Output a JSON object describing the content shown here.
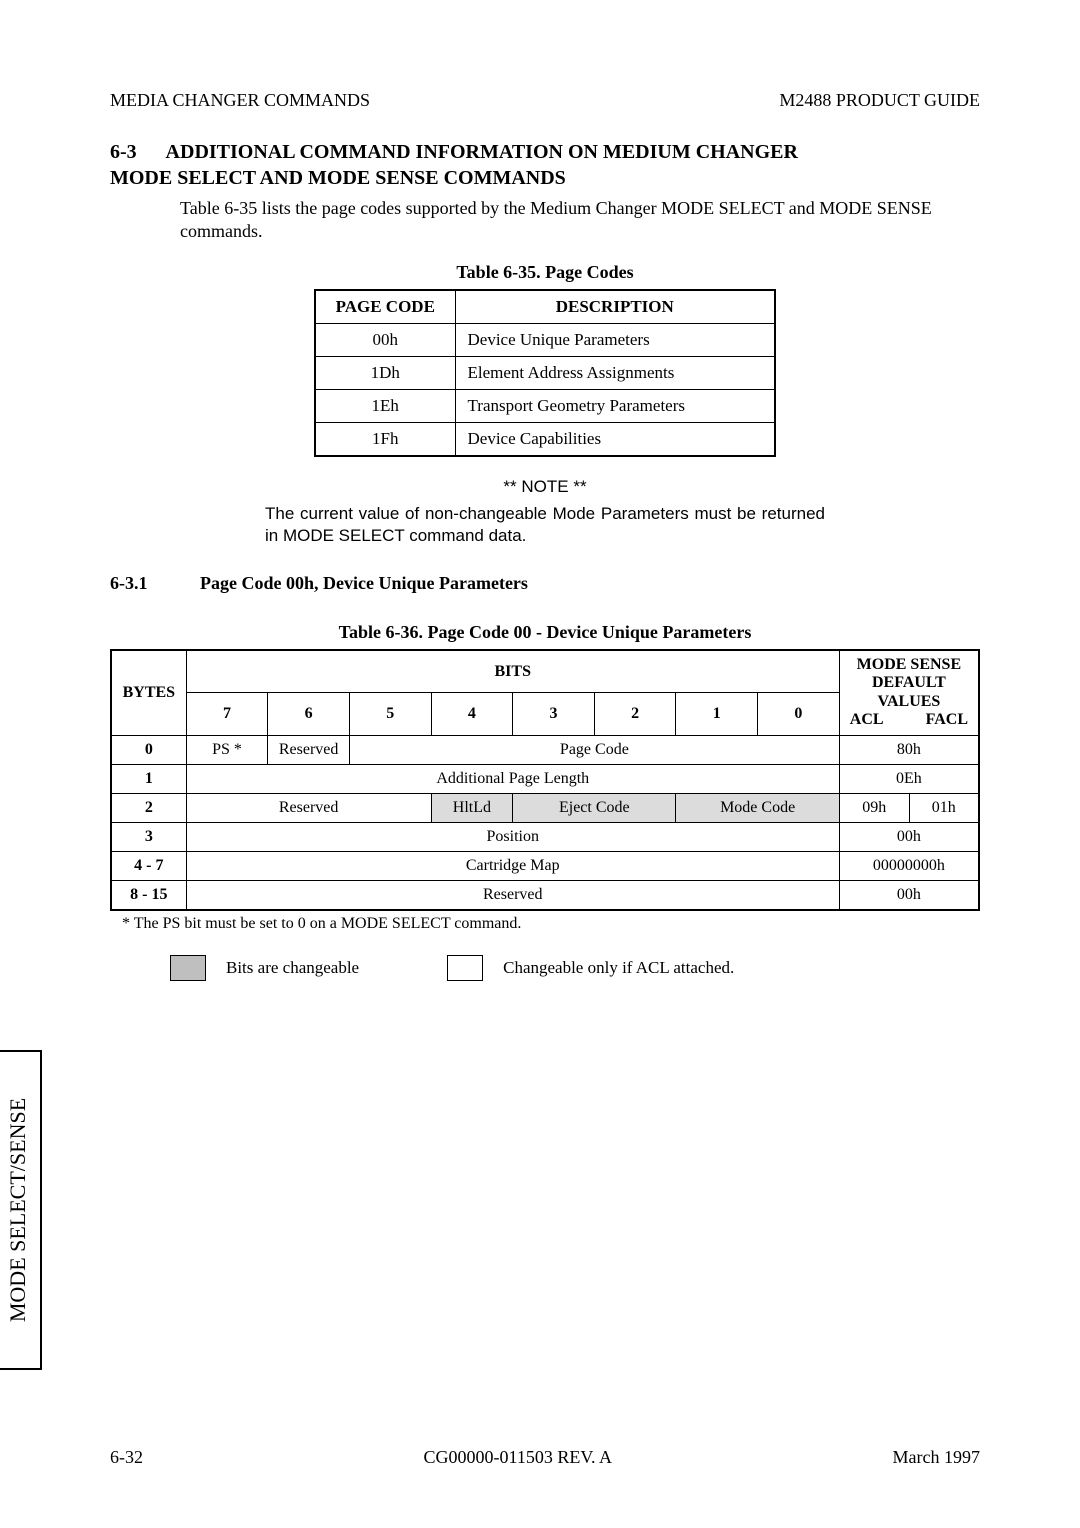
{
  "header": {
    "left": "MEDIA CHANGER COMMANDS",
    "right": "M2488 PRODUCT GUIDE"
  },
  "section": {
    "num_line": "6-3      ADDITIONAL COMMAND INFORMATION ON MEDIUM CHANGER",
    "subtitle": "MODE SELECT AND MODE SENSE COMMANDS",
    "intro": "Table 6-35 lists the page codes supported by the Medium Changer MODE SELECT and MODE SENSE commands."
  },
  "table35": {
    "caption": "Table 6-35.   Page Codes",
    "head_code": "PAGE CODE",
    "head_desc": "DESCRIPTION",
    "rows": [
      {
        "code": "00h",
        "desc": "Device Unique Parameters"
      },
      {
        "code": "1Dh",
        "desc": "Element Address Assignments"
      },
      {
        "code": "1Eh",
        "desc": "Transport Geometry Parameters"
      },
      {
        "code": "1Fh",
        "desc": "Device Capabilities"
      }
    ]
  },
  "note": {
    "title": "** NOTE **",
    "body": "The current value of non-changeable Mode Parameters must be returned in MODE SELECT command data."
  },
  "sub631": {
    "num": "6-3.1",
    "title": "Page Code 00h, Device Unique Parameters"
  },
  "table36": {
    "caption": "Table 6-36.   Page Code 00 - Device Unique Parameters",
    "bytes": "BYTES",
    "bits": "BITS",
    "bitnums": [
      "7",
      "6",
      "5",
      "4",
      "3",
      "2",
      "1",
      "0"
    ],
    "modesense": "MODE SENSE",
    "default": "DEFAULT",
    "values": "VALUES",
    "acl": "ACL",
    "facl": "FACL",
    "rows": {
      "r0_byte": "0",
      "r0_ps": "PS *",
      "r0_res": "Reserved",
      "r0_pc": "Page Code",
      "r0_val": "80h",
      "r1_byte": "1",
      "r1_apl": "Additional Page Length",
      "r1_val": "0Eh",
      "r2_byte": "2",
      "r2_res": "Reserved",
      "r2_hlt": "HltLd",
      "r2_ej": "Eject Code",
      "r2_mc": "Mode Code",
      "r2_acl": "09h",
      "r2_facl": "01h",
      "r3_byte": "3",
      "r3_pos": "Position",
      "r3_val": "00h",
      "r4_byte": "4 - 7",
      "r4_cm": "Cartridge Map",
      "r4_val": "00000000h",
      "r5_byte": "8 - 15",
      "r5_res": "Reserved",
      "r5_val": "00h"
    }
  },
  "footnote": "* The PS bit must be set to 0 on a MODE SELECT command.",
  "legend": {
    "changeable": "Bits are changeable",
    "acl": "Changeable only if ACL attached."
  },
  "sidebar": "MODE SELECT/SENSE",
  "footer": {
    "left": "6-32",
    "center": "CG00000-011503 REV. A",
    "right": "March 1997"
  }
}
